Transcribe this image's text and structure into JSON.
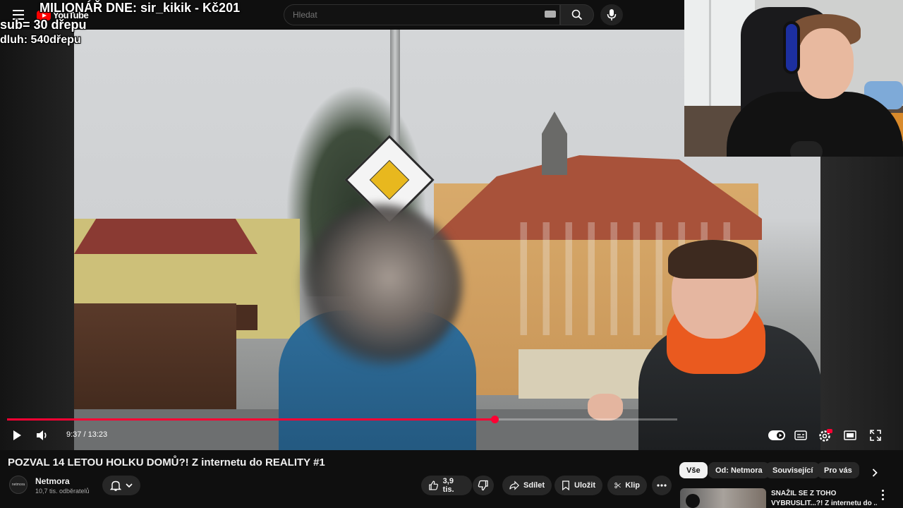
{
  "overlay": {
    "title": "MILIONÁŘ DNE: sir_kikik - Kč201",
    "sub_counter": "sub= 30 dřepu",
    "debt_counter": "dluh: 540dřepu"
  },
  "topbar": {
    "logo_text": "YouTube",
    "search_placeholder": "Hledat",
    "icons": [
      "menu-icon",
      "keyboard-icon",
      "search-icon",
      "microphone-icon"
    ]
  },
  "player": {
    "time_current": "9:37",
    "time_separator": " / ",
    "time_total": "13:23",
    "progress": 0.7275,
    "accent_color": "#ff0033",
    "controls_left": [
      "play-icon",
      "volume-icon"
    ],
    "controls_right": [
      "autoplay-toggle",
      "subtitles-icon",
      "settings-icon",
      "miniplayer-icon",
      "fullscreen-icon"
    ]
  },
  "video": {
    "title": "POZVAL 14 LETOU HOLKU DOMŮ?! Z internetu do REALITY #1"
  },
  "channel": {
    "avatar_text": "netmora",
    "name": "Netmora",
    "subscribers": "10,7 tis. odběratelů"
  },
  "actions": {
    "likes": "3,9 tis.",
    "share": "Sdílet",
    "save": "Uložit",
    "clip": "Klip"
  },
  "filter_chips": [
    "Vše",
    "Od: Netmora",
    "Související",
    "Pro vás"
  ],
  "recommended": [
    {
      "title_line1": "SNAŽIL SE Z TOHO",
      "title_line2": "VYBRUSLIT...?! Z internetu do ..."
    }
  ]
}
